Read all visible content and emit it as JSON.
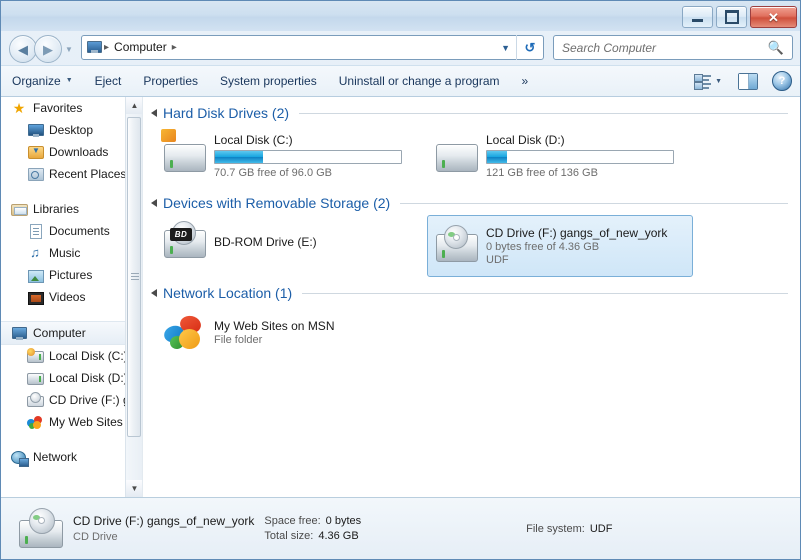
{
  "window": {
    "controls": {
      "minimize": "Minimize",
      "maximize": "Maximize",
      "close": "Close",
      "close_glyph": "✕"
    }
  },
  "navigation": {
    "back_label": "Back",
    "forward_label": "Forward",
    "recent_pages_label": "Recent pages",
    "breadcrumb": {
      "root_icon": "computer-icon",
      "items": [
        "Computer"
      ],
      "separator": "▸"
    },
    "address_dropdown": "▼",
    "refresh_glyph": "↻",
    "refresh_label": "Refresh"
  },
  "search": {
    "placeholder": "Search Computer",
    "icon": "search-icon"
  },
  "toolbar": {
    "organize": "Organize",
    "organize_caret": "▼",
    "eject": "Eject",
    "properties": "Properties",
    "system_properties": "System properties",
    "uninstall": "Uninstall or change a program",
    "overflow": "»",
    "view_caret": "▼",
    "view_label": "Change your view",
    "preview_pane_label": "Show the preview pane",
    "help_label": "Help",
    "help_glyph": "?"
  },
  "sidebar": {
    "groups": [
      {
        "label": "Favorites",
        "icon": "star-icon",
        "items": [
          {
            "label": "Desktop",
            "icon": "desktop-icon"
          },
          {
            "label": "Downloads",
            "icon": "downloads-icon"
          },
          {
            "label": "Recent Places",
            "icon": "recent-places-icon"
          }
        ]
      },
      {
        "label": "Libraries",
        "icon": "libraries-icon",
        "items": [
          {
            "label": "Documents",
            "icon": "documents-icon"
          },
          {
            "label": "Music",
            "icon": "music-icon"
          },
          {
            "label": "Pictures",
            "icon": "pictures-icon"
          },
          {
            "label": "Videos",
            "icon": "videos-icon"
          }
        ]
      },
      {
        "label": "Computer",
        "icon": "computer-icon",
        "selected": true,
        "items": [
          {
            "label": "Local Disk (C:)",
            "icon": "hard-disk-windows-icon"
          },
          {
            "label": "Local Disk (D:)",
            "icon": "hard-disk-icon"
          },
          {
            "label": "CD Drive (F:) gar",
            "icon": "cd-drive-icon"
          },
          {
            "label": "My Web Sites or",
            "icon": "msn-butterfly-icon"
          }
        ]
      },
      {
        "label": "Network",
        "icon": "network-icon",
        "items": []
      }
    ],
    "scroll_up": "▲",
    "scroll_down": "▼"
  },
  "content": {
    "groups": [
      {
        "title": "Hard Disk Drives (2)",
        "collapsed": false,
        "items": [
          {
            "name": "Local Disk (C:)",
            "sub": "70.7 GB free of 96.0 GB",
            "icon": "hard-disk-windows-icon",
            "has_bar": true,
            "used_percent": 26,
            "selected": false
          },
          {
            "name": "Local Disk (D:)",
            "sub": "121 GB free of 136 GB",
            "icon": "hard-disk-icon",
            "has_bar": true,
            "used_percent": 11,
            "selected": false
          }
        ]
      },
      {
        "title": "Devices with Removable Storage (2)",
        "collapsed": false,
        "items": [
          {
            "name": "BD-ROM Drive (E:)",
            "sub": "",
            "sub2": "",
            "icon": "bd-rom-drive-icon",
            "badge": "BD",
            "has_bar": false,
            "selected": false
          },
          {
            "name": "CD Drive (F:) gangs_of_new_york",
            "sub": "0 bytes free of 4.36 GB",
            "sub2": "UDF",
            "icon": "cd-drive-icon",
            "has_bar": false,
            "selected": true
          }
        ]
      },
      {
        "title": "Network Location (1)",
        "collapsed": false,
        "items": [
          {
            "name": "My Web Sites on MSN",
            "sub": "File folder",
            "icon": "msn-butterfly-icon",
            "has_bar": false,
            "selected": false
          }
        ]
      }
    ]
  },
  "status": {
    "icon": "cd-drive-icon",
    "title": "CD Drive (F:) gangs_of_new_york",
    "subtitle": "CD Drive",
    "space_free_label": "Space free:",
    "space_free_value": "0 bytes",
    "total_size_label": "Total size:",
    "total_size_value": "4.36 GB",
    "file_system_label": "File system:",
    "file_system_value": "UDF"
  },
  "colors": {
    "group_heading": "#1c5ea8",
    "selection_border": "#7aafd8",
    "bar_fill": "#19a6e0",
    "close_button": "#cf503c"
  }
}
